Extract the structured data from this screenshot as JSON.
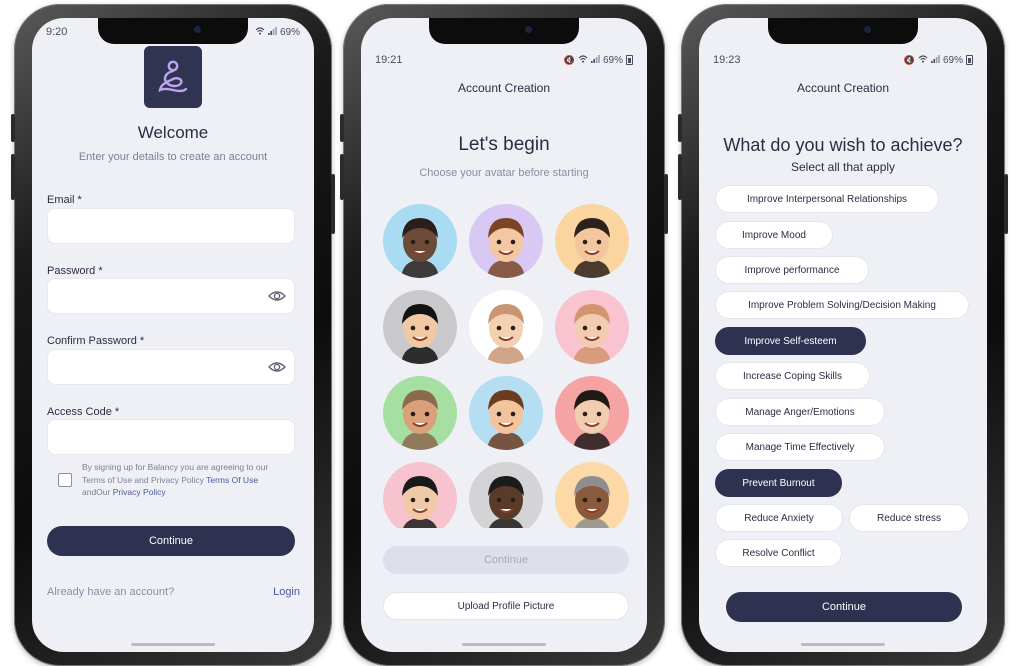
{
  "screen1": {
    "status_time": "9:20",
    "battery": "69%",
    "title": "Welcome",
    "subtitle": "Enter your details to create an account",
    "email_label": "Email *",
    "password_label": "Password *",
    "confirm_password_label": "Confirm Password *",
    "access_code_label": "Access Code *",
    "terms_prefix": "By signing up for Balancy you are agreeing to our Terms of Use and Privacy Policy ",
    "terms_link": "Terms Of Use",
    "terms_middle": "andOur ",
    "privacy_link": "Privacy Policy",
    "continue_label": "Continue",
    "already_text": "Already have an account?",
    "login_label": "Login"
  },
  "screen2": {
    "status_time": "19:21",
    "battery": "69%",
    "header": "Account Creation",
    "title": "Let's begin",
    "subtitle": "Choose your avatar before starting",
    "avatars": [
      {
        "bg": "#a9dcf3",
        "skin": "#6b4a36",
        "hair": "#2a1e1a"
      },
      {
        "bg": "#d8c8f3",
        "skin": "#f2c7a2",
        "hair": "#7a4526"
      },
      {
        "bg": "#fbd5a0",
        "skin": "#f3c6a0",
        "hair": "#2d211c"
      },
      {
        "bg": "#c9c9cb",
        "skin": "#f0c8a3",
        "hair": "#111111"
      },
      {
        "bg": "#ffffff",
        "skin": "#f4d0b3",
        "hair": "#c99572"
      },
      {
        "bg": "#f9c4cf",
        "skin": "#f3cbb1",
        "hair": "#d4946f"
      },
      {
        "bg": "#a6dfa2",
        "skin": "#d9a07a",
        "hair": "#8b6a4f"
      },
      {
        "bg": "#b5def3",
        "skin": "#f1c49d",
        "hair": "#6b3c20"
      },
      {
        "bg": "#f6a3a3",
        "skin": "#f1cdb0",
        "hair": "#1f1a17"
      },
      {
        "bg": "#f6c3cf",
        "skin": "#f0c9a8",
        "hair": "#1a1a1a"
      },
      {
        "bg": "#d4d4d6",
        "skin": "#5a3a28",
        "hair": "#1b1b1b"
      },
      {
        "bg": "#fcd9a7",
        "skin": "#8a5a3c",
        "hair": "#8e8e8e"
      }
    ],
    "continue_label": "Continue",
    "upload_label": "Upload Profile Picture"
  },
  "screen3": {
    "status_time": "19:23",
    "battery": "69%",
    "header": "Account Creation",
    "title": "What do you wish to achieve?",
    "subtitle": "Select all that apply",
    "chips": [
      {
        "label": "Improve Interpersonal Relationships",
        "selected": false
      },
      {
        "label": "Improve Mood",
        "selected": false
      },
      {
        "label": "Improve performance",
        "selected": false
      },
      {
        "label": "Improve Problem Solving/Decision Making",
        "selected": false
      },
      {
        "label": "Improve Self-esteem",
        "selected": true
      },
      {
        "label": "Increase Coping Skills",
        "selected": false
      },
      {
        "label": "Manage Anger/Emotions",
        "selected": false
      },
      {
        "label": "Manage Time Effectively",
        "selected": false
      },
      {
        "label": "Prevent Burnout",
        "selected": true
      },
      {
        "label": "Reduce Anxiety",
        "selected": false
      },
      {
        "label": "Reduce stress",
        "selected": false
      },
      {
        "label": "Resolve Conflict",
        "selected": false
      }
    ],
    "continue_label": "Continue"
  },
  "colors": {
    "primary": "#2e3250",
    "background": "#eef0f6",
    "link": "#4c5a9e",
    "logo_accent": "#b9a5f0"
  },
  "icons": [
    "app-logo-icon",
    "eye-icon",
    "checkbox-icon",
    "wifi-icon",
    "signal-icon",
    "battery-icon",
    "mute-icon"
  ]
}
